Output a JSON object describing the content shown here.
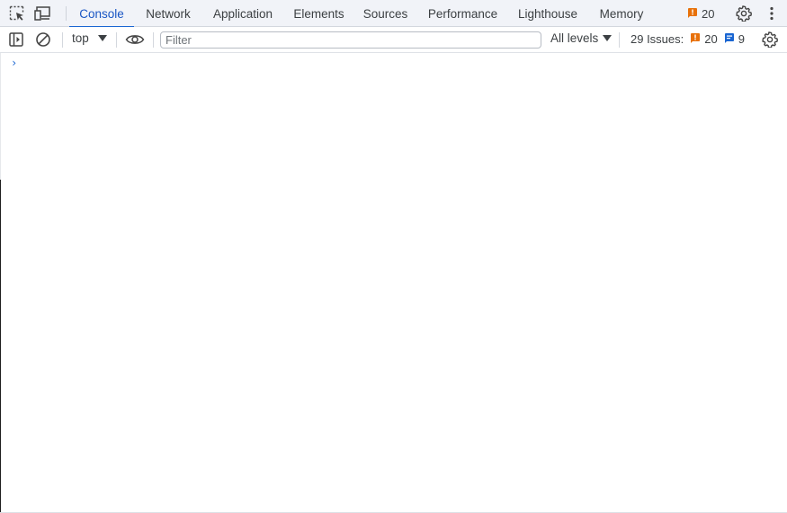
{
  "tabbar": {
    "tabs": [
      {
        "label": "Console",
        "active": true
      },
      {
        "label": "Network",
        "active": false
      },
      {
        "label": "Application",
        "active": false
      },
      {
        "label": "Elements",
        "active": false
      },
      {
        "label": "Sources",
        "active": false
      },
      {
        "label": "Performance",
        "active": false
      },
      {
        "label": "Lighthouse",
        "active": false
      },
      {
        "label": "Memory",
        "active": false
      }
    ],
    "issue_count": "20",
    "icons": [
      "inspect-element-icon",
      "device-toolbar-icon",
      "issue-flag-icon",
      "settings-gear-icon",
      "more-options-icon"
    ]
  },
  "toolbar": {
    "context": "top",
    "filter_placeholder": "Filter",
    "filter_value": "",
    "levels": "All levels",
    "issues_label": "29 Issues:",
    "issues_warnings": "20",
    "issues_info": "9",
    "icons": [
      "sidebar-toggle-icon",
      "clear-console-icon",
      "live-expression-eye-icon",
      "console-settings-gear-icon"
    ]
  },
  "console": {
    "prompt": "›"
  },
  "colors": {
    "accent": "#1a66d2",
    "warning": "#e8710a",
    "info": "#1a66d2",
    "tabbar_bg": "#f1f3f8"
  }
}
